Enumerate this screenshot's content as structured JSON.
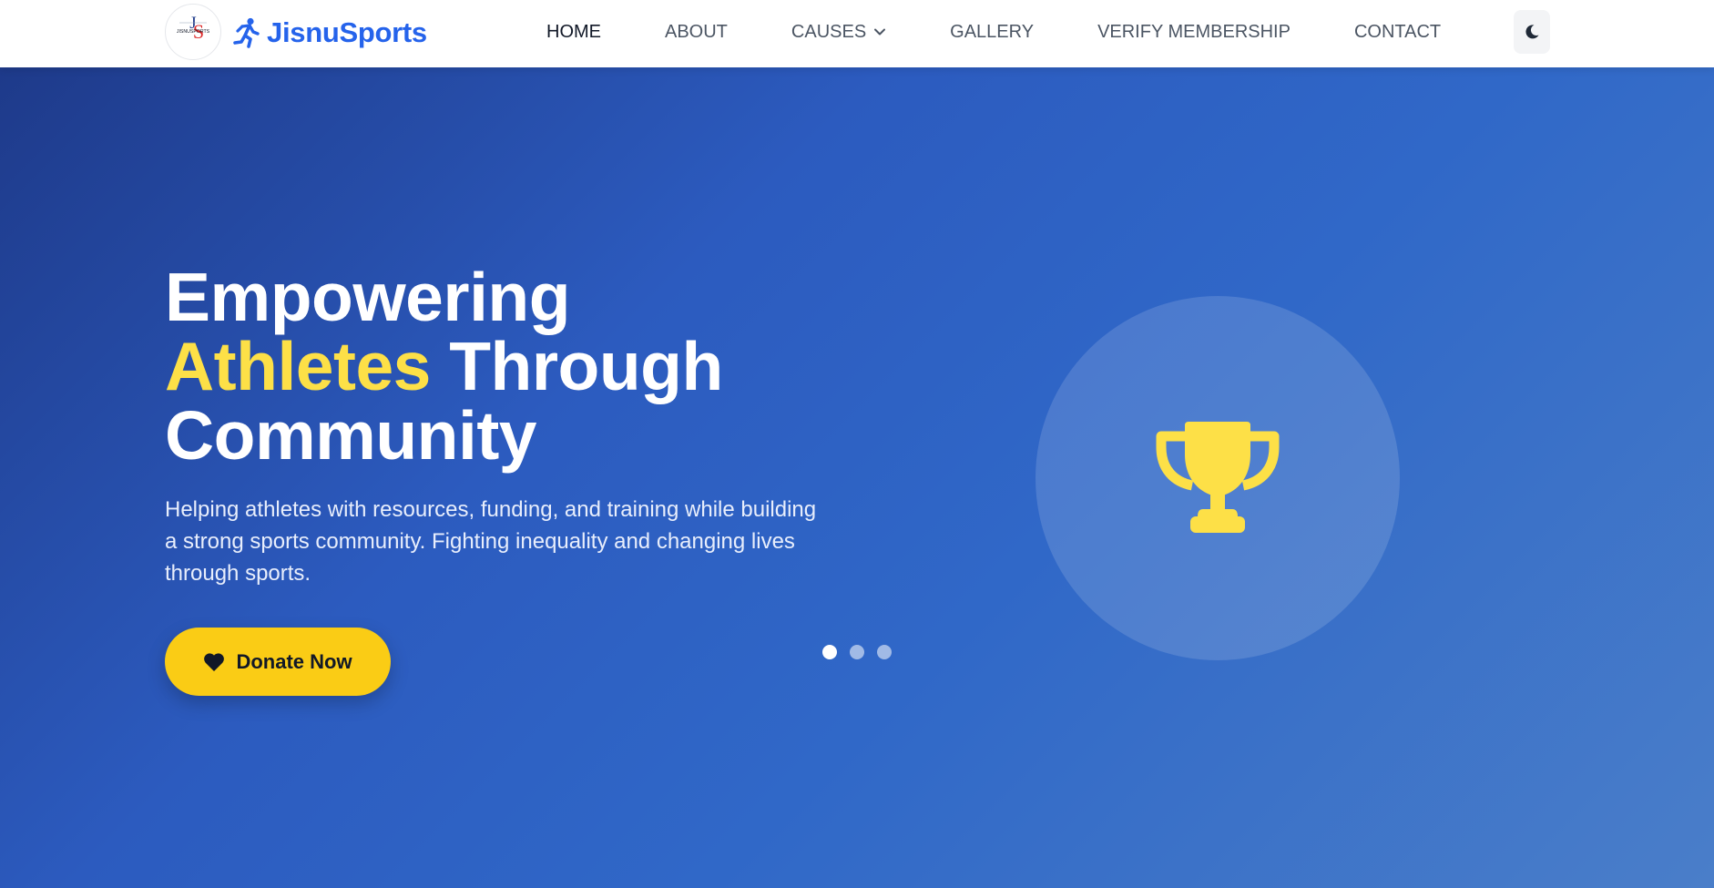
{
  "brand": {
    "logo_text": "JISNUSPORTS",
    "logo_initials": "JS",
    "name": "JisnuSports",
    "icon": "running-person-icon"
  },
  "nav": {
    "items": [
      {
        "label": "HOME",
        "active": true
      },
      {
        "label": "ABOUT",
        "active": false
      },
      {
        "label": "CAUSES",
        "active": false,
        "dropdown": true
      },
      {
        "label": "GALLERY",
        "active": false
      },
      {
        "label": "VERIFY MEMBERSHIP",
        "active": false
      },
      {
        "label": "CONTACT",
        "active": false
      }
    ],
    "theme_toggle_icon": "moon-icon"
  },
  "hero": {
    "title_line1": "Empowering",
    "title_accent": "Athletes",
    "title_line2_rest": " Through",
    "title_line3": "Community",
    "description": "Helping athletes with resources, funding, and training while building a strong sports community. Fighting inequality and changing lives through sports.",
    "donate_label": "Donate Now",
    "donate_icon": "heart-icon",
    "feature_icon": "trophy-icon",
    "slides_count": 3,
    "active_slide": 1
  },
  "colors": {
    "brand_blue": "#2563eb",
    "accent_yellow": "#fde047",
    "button_yellow": "#facc15",
    "hero_gradient_start": "#1e3a8a",
    "hero_gradient_end": "#4a7ec9"
  }
}
